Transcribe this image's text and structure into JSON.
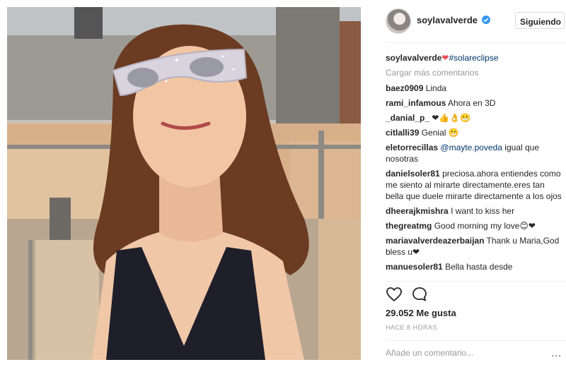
{
  "header": {
    "username": "soylavalverde",
    "follow_label": "Siguiendo"
  },
  "caption": {
    "username": "soylavalverde",
    "emoji": "❤",
    "hashtag": "#solareclipse"
  },
  "load_more": "Cargar más comentarios",
  "comments": [
    {
      "user": "baez0909",
      "text": "Linda"
    },
    {
      "user": "rami_infamous",
      "text": "Ahora en 3D"
    },
    {
      "user": "_danial_p_",
      "text": "❤👍👌😬"
    },
    {
      "user": "citlalli39",
      "text": "Genial 😬"
    },
    {
      "user": "eletorrecillas",
      "mention": "@mayte.poveda",
      "text": " igual que nosotras"
    },
    {
      "user": "danielsoler81",
      "text": "preciosa.ahora entiendes como me siento al mirarte directamente.eres tan bella que duele mirarte directamente a los ojos"
    },
    {
      "user": "dheerajkmishra",
      "text": "I want to kiss her"
    },
    {
      "user": "thegreatmg",
      "text": "Good morning my love😊❤"
    },
    {
      "user": "mariavalverdeazerbaijan",
      "text": "Thank u Maria,God bless u❤"
    },
    {
      "user": "manuesoler81",
      "text": "Bella hasta desde"
    }
  ],
  "likes": "29.052 Me gusta",
  "time": "HACE 8 HORAS",
  "add_comment_placeholder": "Añade un comentario...",
  "more_label": "...",
  "icons": {
    "verified": "verified-badge-icon",
    "like": "heart-icon",
    "comment": "comment-icon",
    "more": "more-options-icon"
  },
  "colors": {
    "verified": "#3897f0",
    "link": "#003569",
    "muted": "#999999"
  }
}
